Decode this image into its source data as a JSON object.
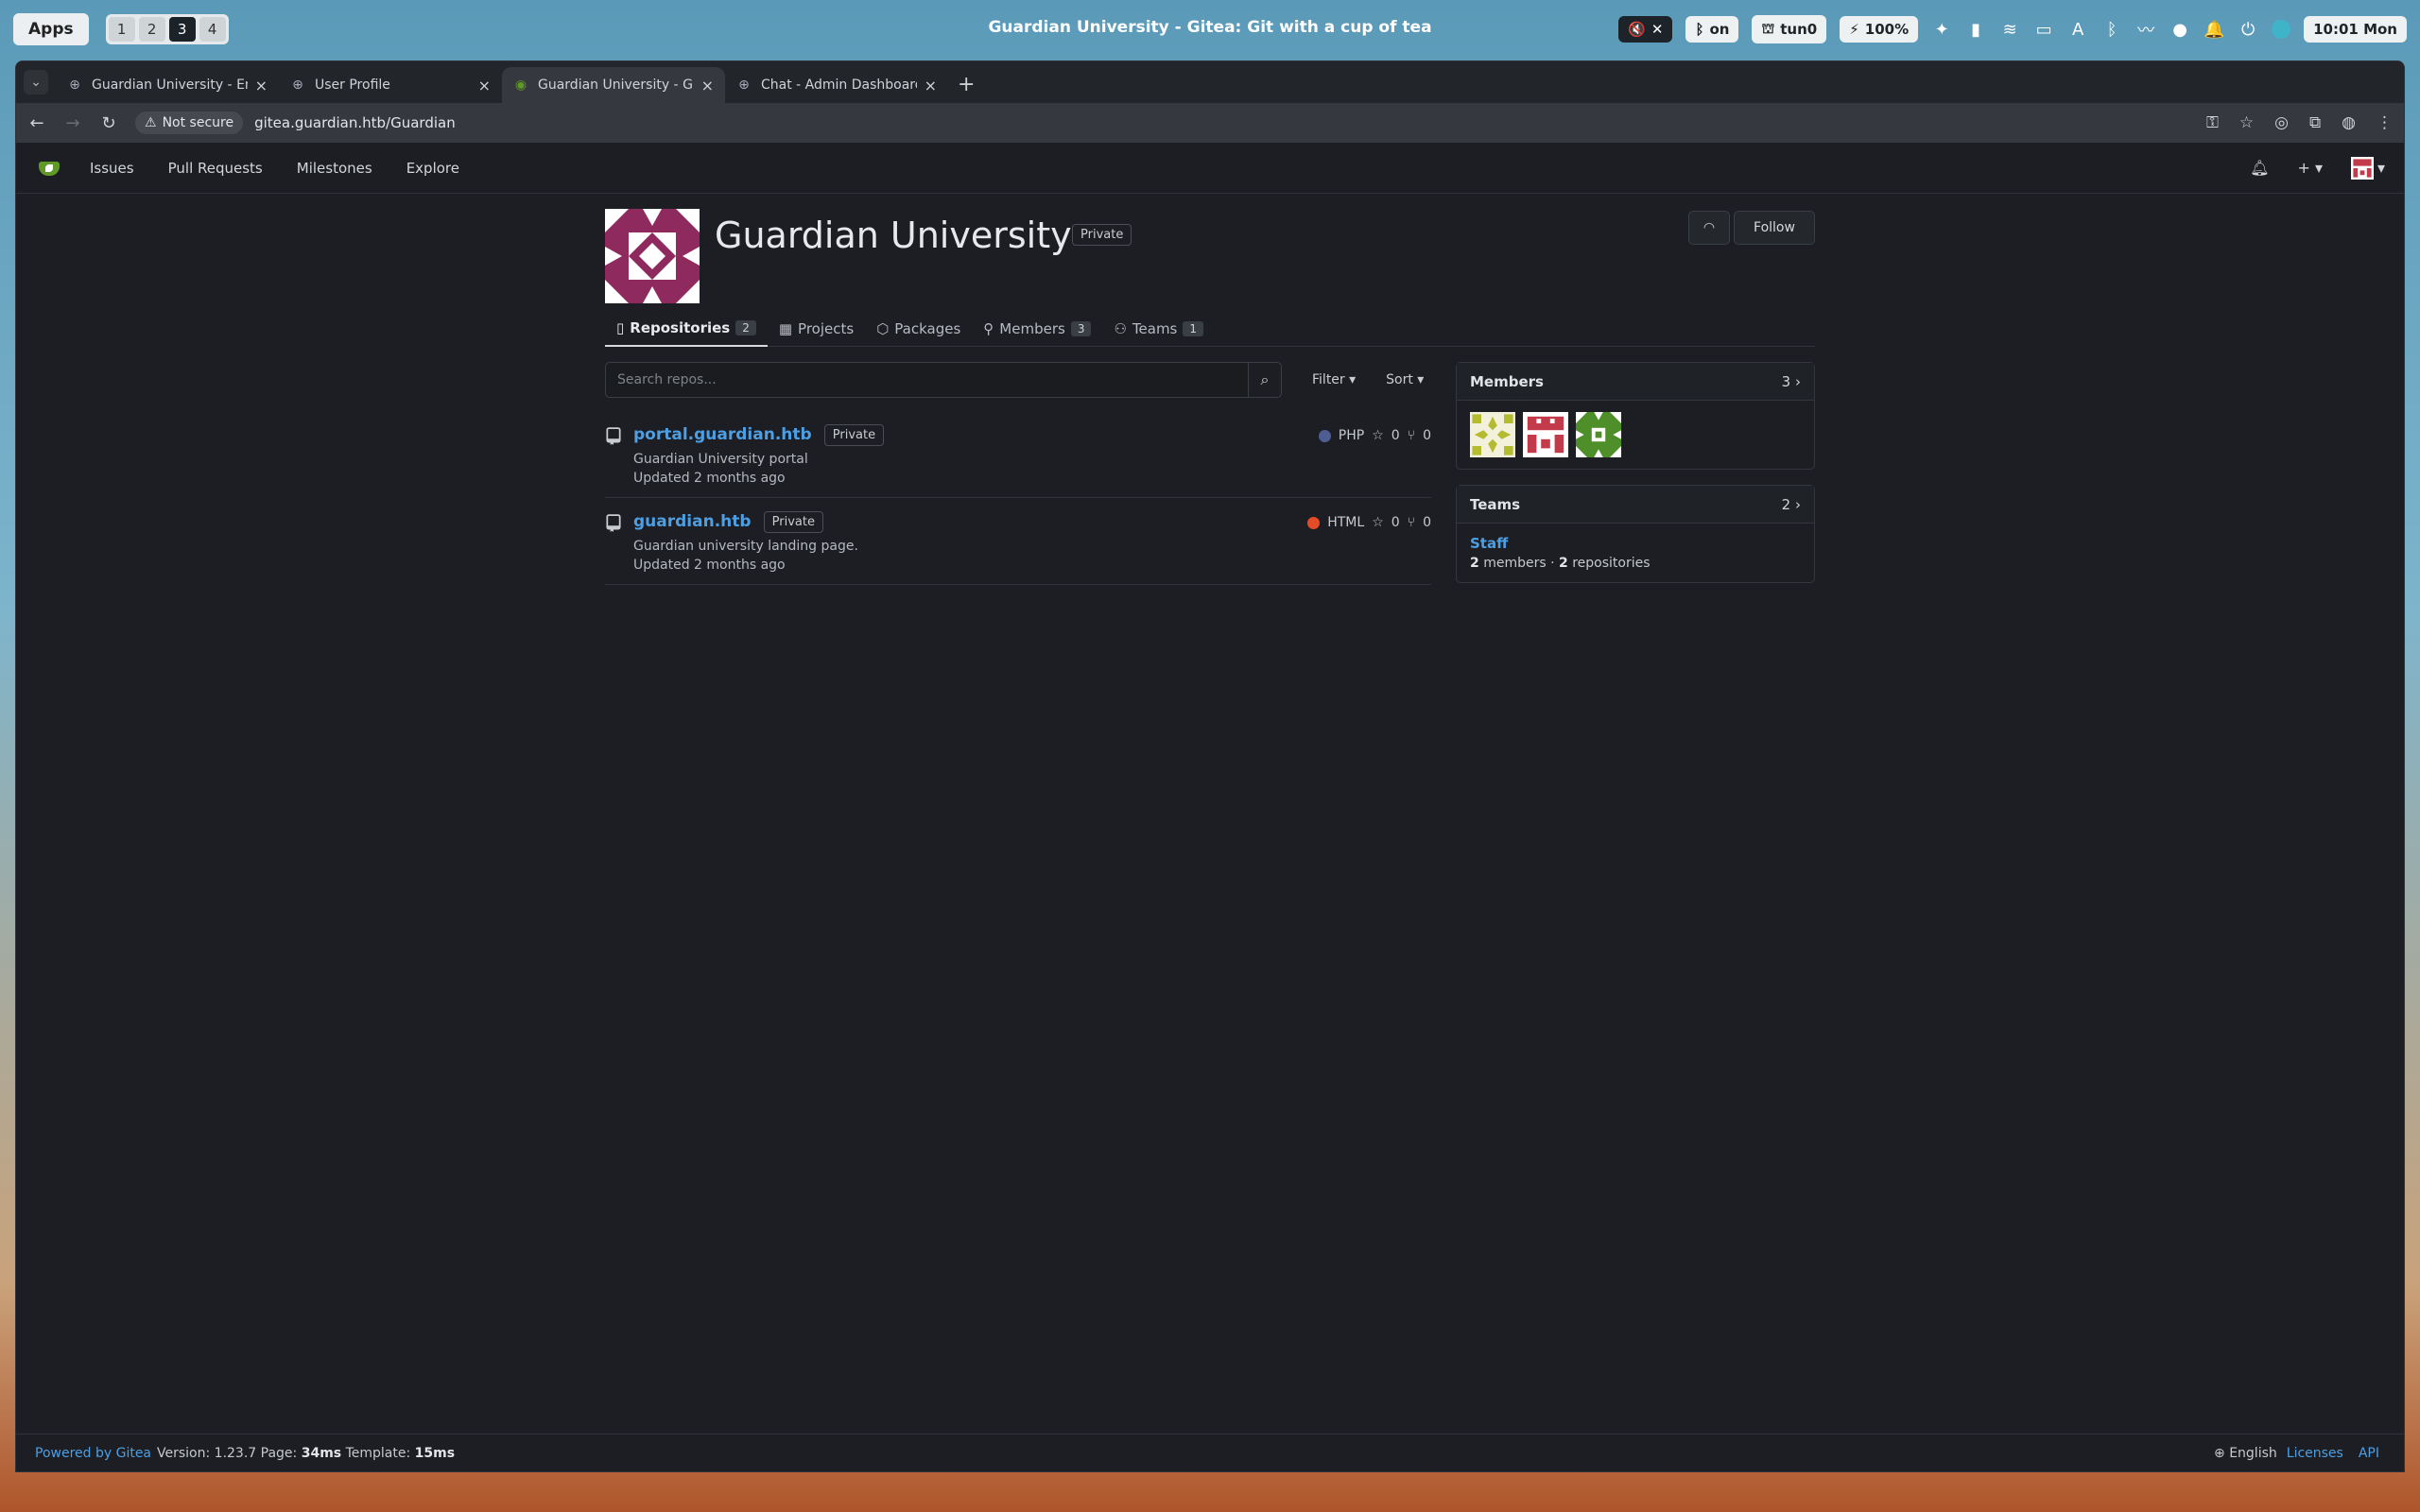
{
  "system": {
    "apps_label": "Apps",
    "workspaces": [
      "1",
      "2",
      "3",
      "4"
    ],
    "window_title": "Guardian University - Gitea: Git with a cup of tea",
    "bt_label": "on",
    "vpn_label": "tun0",
    "battery_label": "100%",
    "clock": "10:01 Mon"
  },
  "browser": {
    "tabs": [
      {
        "title": "Guardian University - Em"
      },
      {
        "title": "User Profile"
      },
      {
        "title": "Guardian University - Git"
      },
      {
        "title": "Chat - Admin Dashboard"
      }
    ],
    "not_secure_label": "Not secure",
    "url": "gitea.guardian.htb/Guardian"
  },
  "gitea_nav": {
    "items": [
      "Issues",
      "Pull Requests",
      "Milestones",
      "Explore"
    ]
  },
  "org": {
    "name": "Guardian University",
    "visibility": "Private",
    "follow_label": "Follow",
    "avatar_color": "#8f2a5e"
  },
  "org_tabs": [
    {
      "label": "Repositories",
      "count": "2"
    },
    {
      "label": "Projects"
    },
    {
      "label": "Packages"
    },
    {
      "label": "Members",
      "count": "3"
    },
    {
      "label": "Teams",
      "count": "1"
    }
  ],
  "search": {
    "placeholder": "Search repos...",
    "filter_label": "Filter",
    "sort_label": "Sort"
  },
  "repos": [
    {
      "name": "portal.guardian.htb",
      "visibility": "Private",
      "description": "Guardian University portal",
      "updated": "Updated 2 months ago",
      "language": "PHP",
      "language_color": "#4f5d95",
      "stars": "0",
      "forks": "0"
    },
    {
      "name": "guardian.htb",
      "visibility": "Private",
      "description": "Guardian university landing page.",
      "updated": "Updated 2 months ago",
      "language": "HTML",
      "language_color": "#e34c26",
      "stars": "0",
      "forks": "0"
    }
  ],
  "members_panel": {
    "title": "Members",
    "count": "3"
  },
  "teams_panel": {
    "title": "Teams",
    "count": "2",
    "team_name": "Staff",
    "members_count": "2",
    "members_label": "members",
    "separator": "·",
    "repos_count": "2",
    "repos_label": "repositories"
  },
  "footer": {
    "powered_by": "Powered by Gitea",
    "version_label": "Version: 1.23.7",
    "page_label": "Page:",
    "page_time": "34ms",
    "template_label": "Template:",
    "template_time": "15ms",
    "language": "English",
    "licenses": "Licenses",
    "api": "API"
  },
  "icons": {
    "search": "search-icon",
    "rss": "rss-icon",
    "repo": "repo-icon",
    "star": "star-icon",
    "fork": "fork-icon",
    "bell": "bell-icon",
    "plus": "plus-icon",
    "globe": "globe-icon"
  }
}
